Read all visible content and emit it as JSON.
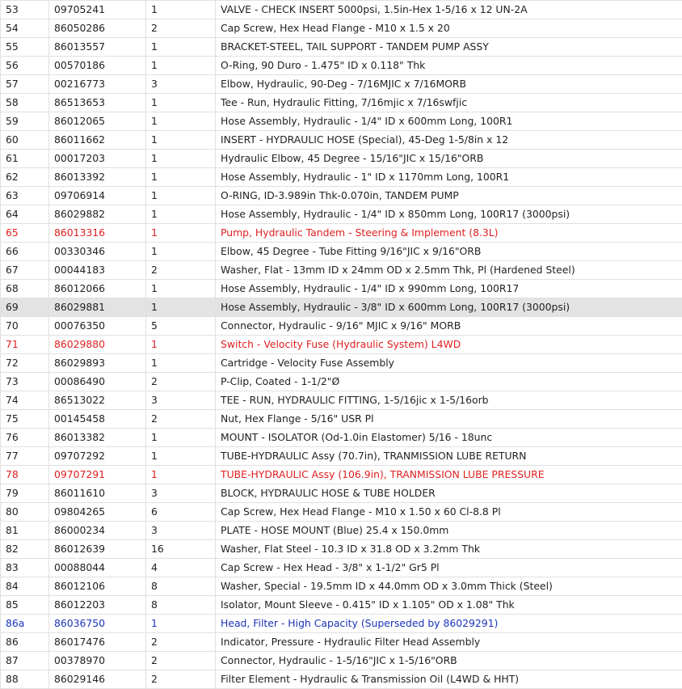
{
  "colors": {
    "highlight_red": "#e02020",
    "link_blue": "#1a33b8",
    "selected_row_bg": "#e3e3e3"
  },
  "rows": [
    {
      "num": "53",
      "part": "09705241",
      "qty": "1",
      "desc": "VALVE - CHECK INSERT 5000psi, 1.5in-Hex 1-5/16 x 12 UN-2A",
      "style": ""
    },
    {
      "num": "54",
      "part": "86050286",
      "qty": "2",
      "desc": "Cap Screw, Hex Head Flange - M10 x 1.5 x 20",
      "style": ""
    },
    {
      "num": "55",
      "part": "86013557",
      "qty": "1",
      "desc": "BRACKET-STEEL, TAIL SUPPORT - TANDEM PUMP ASSY",
      "style": ""
    },
    {
      "num": "56",
      "part": "00570186",
      "qty": "1",
      "desc": "O-Ring, 90 Duro - 1.475\" ID x 0.118\" Thk",
      "style": ""
    },
    {
      "num": "57",
      "part": "00216773",
      "qty": "3",
      "desc": "Elbow, Hydraulic, 90-Deg - 7/16MJIC x 7/16MORB",
      "style": ""
    },
    {
      "num": "58",
      "part": "86513653",
      "qty": "1",
      "desc": "Tee - Run, Hydraulic Fitting, 7/16mjic x 7/16swfjic",
      "style": ""
    },
    {
      "num": "59",
      "part": "86012065",
      "qty": "1",
      "desc": "Hose Assembly, Hydraulic - 1/4\" ID x 600mm Long, 100R1",
      "style": ""
    },
    {
      "num": "60",
      "part": "86011662",
      "qty": "1",
      "desc": "INSERT - HYDRAULIC HOSE (Special), 45-Deg 1-5/8in x 12",
      "style": ""
    },
    {
      "num": "61",
      "part": "00017203",
      "qty": "1",
      "desc": "Hydraulic Elbow, 45 Degree - 15/16\"JIC x 15/16\"ORB",
      "style": ""
    },
    {
      "num": "62",
      "part": "86013392",
      "qty": "1",
      "desc": "Hose Assembly, Hydraulic - 1\" ID x 1170mm Long, 100R1",
      "style": ""
    },
    {
      "num": "63",
      "part": "09706914",
      "qty": "1",
      "desc": "O-RING, ID-3.989in Thk-0.070in, TANDEM PUMP",
      "style": ""
    },
    {
      "num": "64",
      "part": "86029882",
      "qty": "1",
      "desc": "Hose Assembly, Hydraulic - 1/4\" ID x 850mm Long, 100R17 (3000psi)",
      "style": ""
    },
    {
      "num": "65",
      "part": "86013316",
      "qty": "1",
      "desc": "Pump, Hydraulic Tandem - Steering & Implement (8.3L)",
      "style": "red"
    },
    {
      "num": "66",
      "part": "00330346",
      "qty": "1",
      "desc": "Elbow, 45 Degree - Tube Fitting 9/16\"JIC x 9/16\"ORB",
      "style": ""
    },
    {
      "num": "67",
      "part": "00044183",
      "qty": "2",
      "desc": "Washer, Flat - 13mm ID x 24mm OD x 2.5mm Thk, Pl (Hardened Steel)",
      "style": ""
    },
    {
      "num": "68",
      "part": "86012066",
      "qty": "1",
      "desc": "Hose Assembly, Hydraulic - 1/4\" ID x 990mm Long, 100R17",
      "style": ""
    },
    {
      "num": "69",
      "part": "86029881",
      "qty": "1",
      "desc": "Hose Assembly, Hydraulic - 3/8\" ID x 600mm Long, 100R17 (3000psi)",
      "style": "hl"
    },
    {
      "num": "70",
      "part": "00076350",
      "qty": "5",
      "desc": "Connector, Hydraulic - 9/16\" MJIC x 9/16\" MORB",
      "style": ""
    },
    {
      "num": "71",
      "part": "86029880",
      "qty": "1",
      "desc": "Switch - Velocity Fuse (Hydraulic System) L4WD",
      "style": "red"
    },
    {
      "num": "72",
      "part": "86029893",
      "qty": "1",
      "desc": "Cartridge - Velocity Fuse Assembly",
      "style": ""
    },
    {
      "num": "73",
      "part": "00086490",
      "qty": "2",
      "desc": "P-Clip, Coated - 1-1/2\"Ø",
      "style": ""
    },
    {
      "num": "74",
      "part": "86513022",
      "qty": "3",
      "desc": "TEE - RUN, HYDRAULIC FITTING, 1-5/16jic x 1-5/16orb",
      "style": ""
    },
    {
      "num": "75",
      "part": "00145458",
      "qty": "2",
      "desc": "Nut, Hex Flange - 5/16\" USR Pl",
      "style": ""
    },
    {
      "num": "76",
      "part": "86013382",
      "qty": "1",
      "desc": "MOUNT - ISOLATOR (Od-1.0in Elastomer) 5/16 - 18unc",
      "style": ""
    },
    {
      "num": "77",
      "part": "09707292",
      "qty": "1",
      "desc": "TUBE-HYDRAULIC Assy (70.7in), TRANMISSION LUBE RETURN",
      "style": ""
    },
    {
      "num": "78",
      "part": "09707291",
      "qty": "1",
      "desc": "TUBE-HYDRAULIC Assy (106.9in), TRANMISSION LUBE PRESSURE",
      "style": "red"
    },
    {
      "num": "79",
      "part": "86011610",
      "qty": "3",
      "desc": "BLOCK, HYDRAULIC HOSE & TUBE HOLDER",
      "style": ""
    },
    {
      "num": "80",
      "part": "09804265",
      "qty": "6",
      "desc": "Cap Screw, Hex Head Flange - M10 x 1.50 x 60 Cl-8.8 Pl",
      "style": ""
    },
    {
      "num": "81",
      "part": "86000234",
      "qty": "3",
      "desc": "PLATE - HOSE MOUNT (Blue) 25.4 x 150.0mm",
      "style": ""
    },
    {
      "num": "82",
      "part": "86012639",
      "qty": "16",
      "desc": "Washer, Flat Steel - 10.3 ID x 31.8 OD x 3.2mm Thk",
      "style": ""
    },
    {
      "num": "83",
      "part": "00088044",
      "qty": "4",
      "desc": "Cap Screw - Hex Head - 3/8\" x 1-1/2\" Gr5 Pl",
      "style": ""
    },
    {
      "num": "84",
      "part": "86012106",
      "qty": "8",
      "desc": "Washer, Special - 19.5mm ID x 44.0mm OD x 3.0mm Thick (Steel)",
      "style": ""
    },
    {
      "num": "85",
      "part": "86012203",
      "qty": "8",
      "desc": "Isolator, Mount Sleeve - 0.415\" ID x 1.105\" OD x 1.08\" Thk",
      "style": ""
    },
    {
      "num": "86a",
      "part": "86036750",
      "qty": "1",
      "desc": "Head, Filter - High Capacity (Superseded by 86029291)",
      "style": "blue"
    },
    {
      "num": "86",
      "part": "86017476",
      "qty": "2",
      "desc": "Indicator, Pressure - Hydraulic Filter Head Assembly",
      "style": ""
    },
    {
      "num": "87",
      "part": "00378970",
      "qty": "2",
      "desc": "Connector, Hydraulic - 1-5/16\"JIC x 1-5/16\"ORB",
      "style": ""
    },
    {
      "num": "88",
      "part": "86029146",
      "qty": "2",
      "desc": "Filter Element - Hydraulic & Transmission Oil (L4WD & HHT)",
      "style": ""
    }
  ]
}
